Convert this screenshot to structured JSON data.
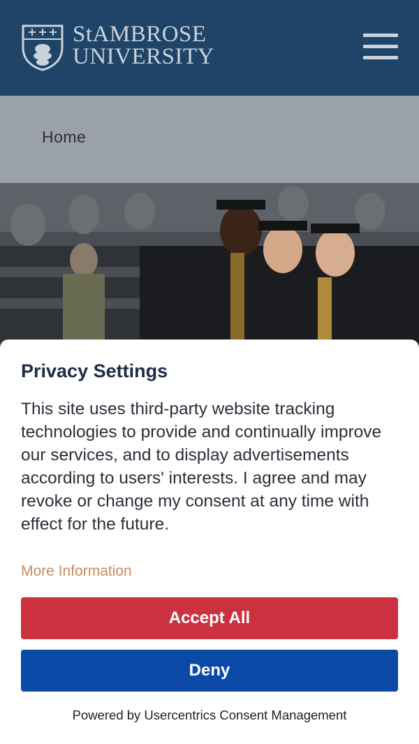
{
  "header": {
    "brand_line1": "StAMBROSE",
    "brand_line2": "UNIVERSITY",
    "colors": {
      "background": "#1f4467",
      "logo": "#c9d3dd"
    }
  },
  "breadcrumb": {
    "home": "Home"
  },
  "hero": {
    "icon": "graduation-photo"
  },
  "consent": {
    "title": "Privacy Settings",
    "text": "This site uses third-party website tracking technologies to provide and continually improve our services, and to display advertisements according to users' interests. I agree and may revoke or change my consent at any time with effect for the future.",
    "more_info": "More Information",
    "accept": "Accept All",
    "deny": "Deny",
    "powered": "Powered by Usercentrics Consent Management",
    "colors": {
      "accept": "#cc3140",
      "deny": "#0a4aa6",
      "link": "#c98a5c"
    }
  }
}
